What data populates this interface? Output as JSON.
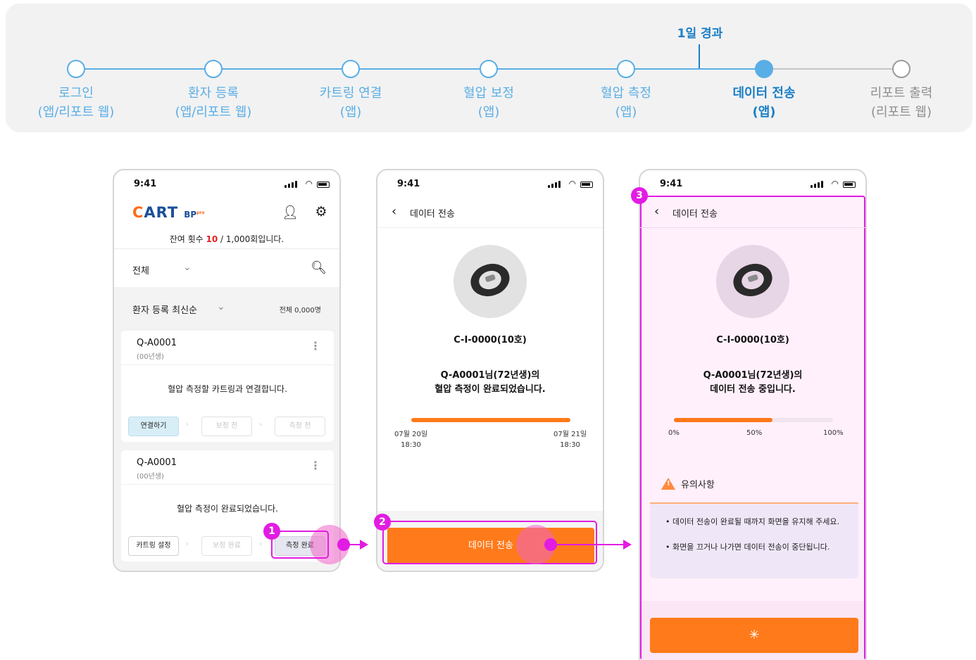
{
  "stepper": {
    "current_label": "1일 경과",
    "steps": [
      {
        "line1": "로그인",
        "line2": "(앱/리포트 웹)"
      },
      {
        "line1": "환자 등록",
        "line2": "(앱/리포트 웹)"
      },
      {
        "line1": "카트링 연결",
        "line2": "(앱)"
      },
      {
        "line1": "혈압 보정",
        "line2": "(앱)"
      },
      {
        "line1": "혈압 측정",
        "line2": "(앱)"
      },
      {
        "line1": "데이터 전송",
        "line2": "(앱)"
      },
      {
        "line1": "리포트 출력",
        "line2": "(리포트 웹)"
      }
    ]
  },
  "status_time": "9:41",
  "phone1": {
    "logo_main": "ART",
    "logo_c": "C",
    "logo_bp": "BP",
    "logo_pro": "pro",
    "remaining_prefix": "잔여 횟수 ",
    "remaining_count": "10",
    "remaining_suffix": " / 1,000회입니다.",
    "filter_label": "전체",
    "sort_label": "환자 등록 최신순",
    "total_label": "전체 0,000명",
    "cards": [
      {
        "id": "Q-A0001",
        "born": "(00년생)",
        "message": "혈압 측정할 카트링과 연결합니다.",
        "btn1": "연결하기",
        "btn2": "보정 전",
        "btn3": "측정 전"
      },
      {
        "id": "Q-A0001",
        "born": "(00년생)",
        "message": "혈압 측정이 완료되었습니다.",
        "btn1": "카트링 설정",
        "btn2": "보정 완료",
        "btn3": "측정 완료"
      }
    ]
  },
  "phone2": {
    "title": "데이터 전송",
    "device": "C-I-0000(10호)",
    "message_line1": "Q-A0001님(72년생)의",
    "message_line2": "혈압 측정이 완료되었습니다.",
    "start_date": "07월 20일",
    "start_time": "18:30",
    "end_date": "07월 21일",
    "end_time": "18:30",
    "cta": "데이터 전송"
  },
  "phone3": {
    "title": "데이터 전송",
    "device": "C-I-0000(10호)",
    "message_line1": "Q-A0001님(72년생)의",
    "message_line2": "데이터 전송 중입니다.",
    "progress": 0.62,
    "tick0": "0%",
    "tick50": "50%",
    "tick100": "100%",
    "notice_title": "유의사항",
    "notice1": "• 데이터 전송이 완료될 때까지 화면을 유지해 주세요.",
    "notice2": "• 화면을 끄거나 나가면 데이터 전송이 중단됩니다.",
    "spinner": "✳"
  },
  "annotations": {
    "b1": "1",
    "b2": "2",
    "b3": "3"
  },
  "colors": {
    "accent_blue": "#5aaee6",
    "active_blue": "#1a7fc6",
    "cta_orange": "#ff7a1a",
    "annotation_magenta": "#e21ce2"
  }
}
